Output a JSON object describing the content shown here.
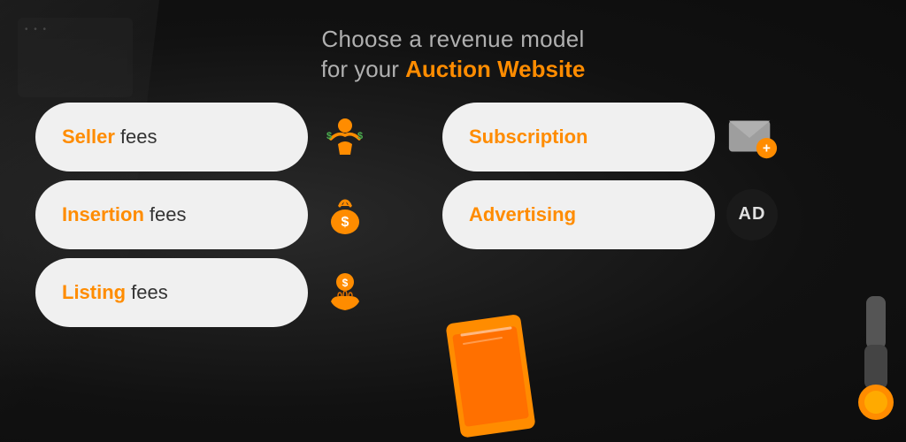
{
  "header": {
    "line1": "Choose a revenue model",
    "line2_prefix": "for your ",
    "line2_highlight": "Auction Website"
  },
  "left_cards": [
    {
      "id": "seller-fees",
      "accent": "Seller",
      "text": " fees",
      "icon": "person-money-icon"
    },
    {
      "id": "insertion-fees",
      "accent": "Insertion",
      "text": " fees",
      "icon": "money-bag-icon"
    },
    {
      "id": "listing-fees",
      "accent": "Listing",
      "text": " fees",
      "icon": "hand-coin-icon"
    }
  ],
  "right_cards": [
    {
      "id": "subscription",
      "accent": "Subscription",
      "text": "",
      "icon": "envelope-plus-icon"
    },
    {
      "id": "advertising",
      "accent": "Advertising",
      "text": "",
      "icon": "ad-circle-icon"
    }
  ],
  "icons": {
    "person-money-icon": "👤💰",
    "money-bag-icon": "💰",
    "hand-coin-icon": "🤲",
    "envelope-plus-icon": "✉️+",
    "ad-circle-icon": "AD"
  }
}
